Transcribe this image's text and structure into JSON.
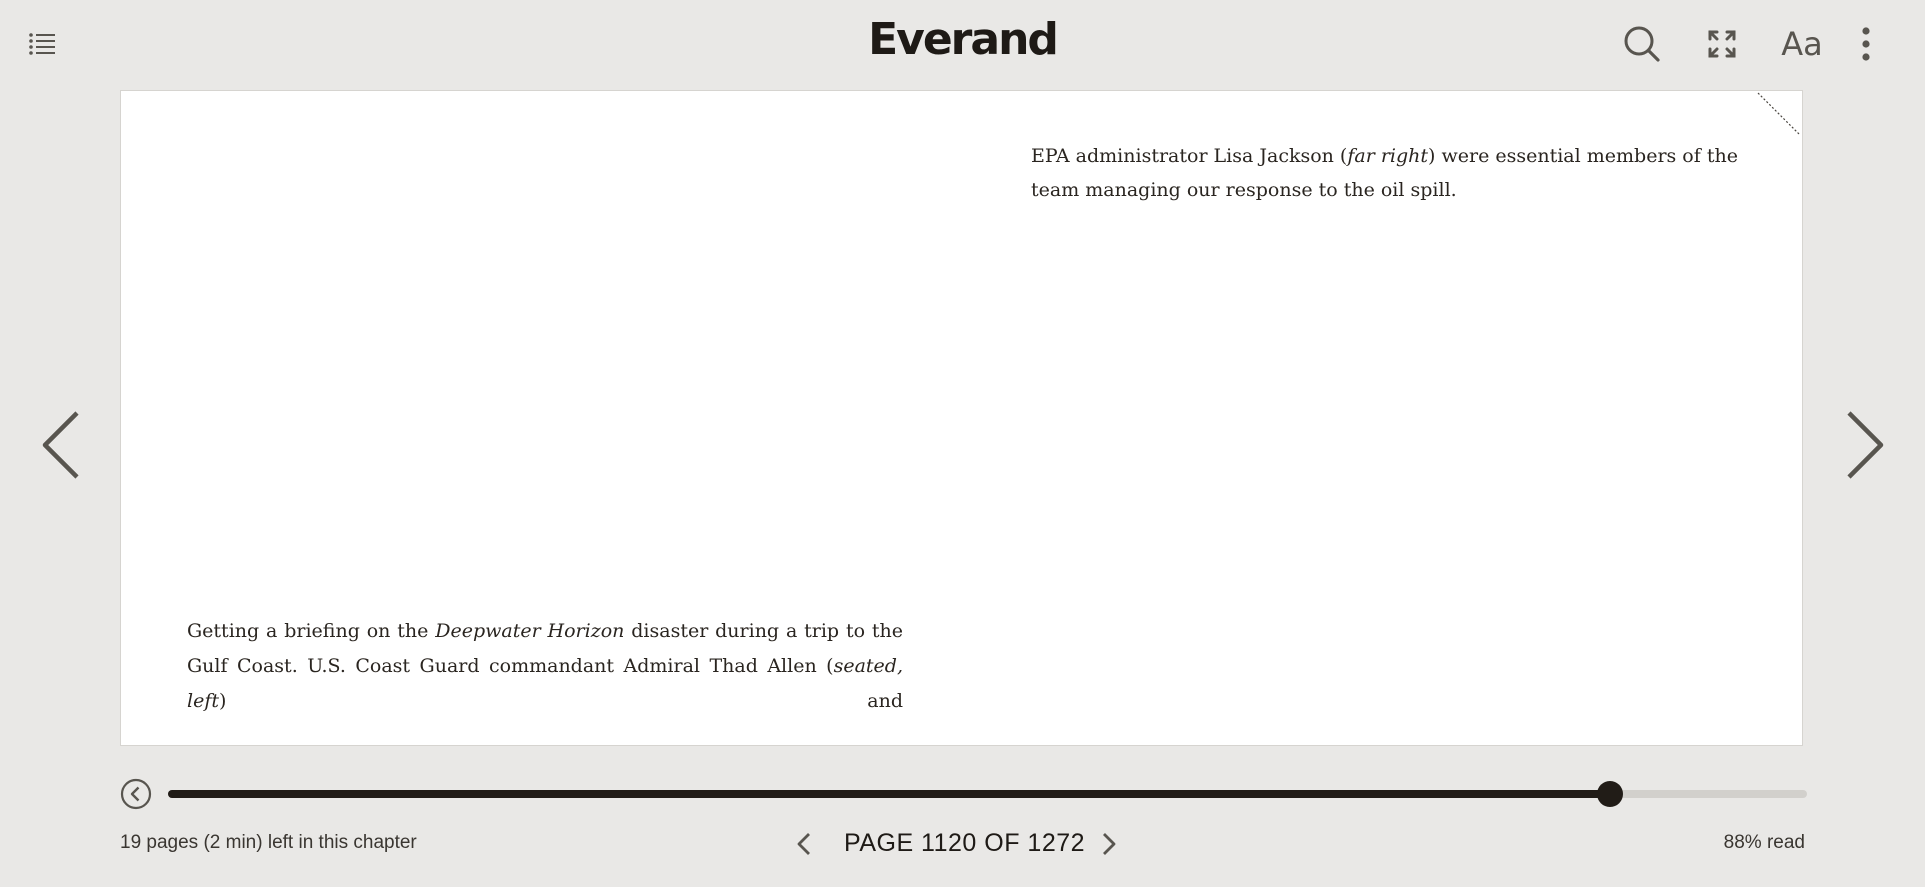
{
  "header": {
    "brand": "Everand",
    "menu_icon": "list-icon",
    "search_icon": "search-icon",
    "fullscreen_icon": "expand-icon",
    "font_settings_label": "Aa",
    "more_icon": "more-vertical-icon"
  },
  "reader": {
    "caption_right": {
      "lead": "EPA administrator Lisa Jackson (",
      "italic": "far right",
      "tail": ") were essential members of the team managing our response to the oil spill."
    },
    "caption_left": {
      "part1": "Getting a briefing on the ",
      "italic1": "Deepwater Horizon",
      "part2": " disaster during a trip to the Gulf Coast. U.S. Coast Guard commandant Admiral Thad Allen (",
      "italic2": "seated, left",
      "part3": ") and"
    },
    "prev_icon": "chevron-left-icon",
    "next_icon": "chevron-right-icon"
  },
  "progress": {
    "back_icon": "circle-back-icon",
    "fraction_read": 0.88
  },
  "footer": {
    "chapter_remaining": "19 pages (2 min) left in this chapter",
    "page_label": "PAGE 1120 OF 1272",
    "percent_read": "88% read"
  },
  "colors": {
    "background": "#e9e8e6",
    "page": "#ffffff",
    "accent": "#211c17",
    "track": "#d2d0cc"
  }
}
